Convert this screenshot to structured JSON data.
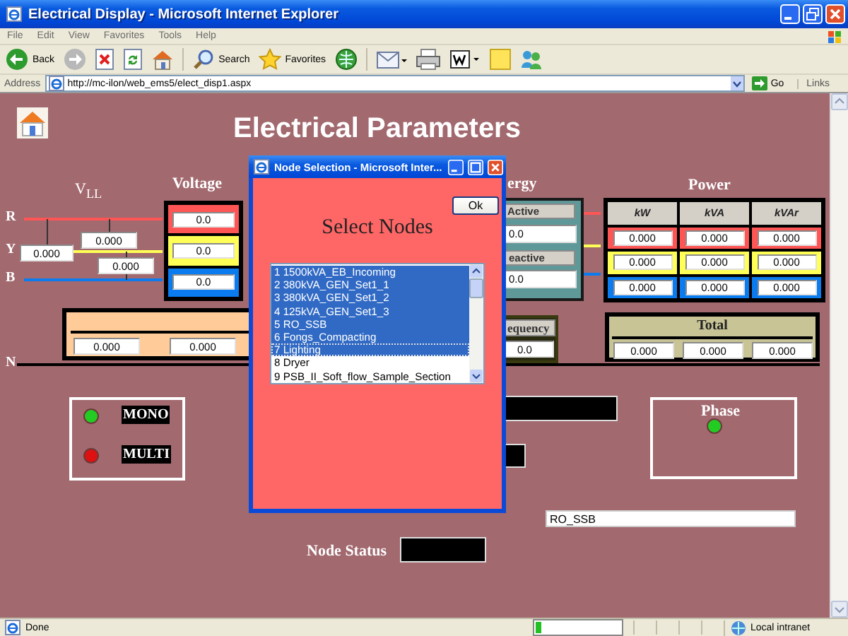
{
  "window": {
    "title": "Electrical Display - Microsoft Internet Explorer"
  },
  "menu": [
    "File",
    "Edit",
    "View",
    "Favorites",
    "Tools",
    "Help"
  ],
  "toolbar": [
    {
      "kind": "back",
      "label": "Back"
    },
    {
      "kind": "forward"
    },
    {
      "kind": "stop"
    },
    {
      "kind": "refresh"
    },
    {
      "kind": "home"
    },
    {
      "kind": "search",
      "label": "Search"
    },
    {
      "kind": "favorites",
      "label": "Favorites"
    },
    {
      "kind": "media"
    },
    {
      "kind": "mail"
    },
    {
      "kind": "print"
    },
    {
      "kind": "edit"
    },
    {
      "kind": "note"
    },
    {
      "kind": "messenger"
    }
  ],
  "address": {
    "label": "Address",
    "url": "http://mc-ilon/web_ems5/elect_disp1.aspx",
    "go": "Go",
    "links": "Links"
  },
  "page": {
    "title": "Electrical Parameters",
    "phases": [
      {
        "label": "R",
        "color": "#ff5555"
      },
      {
        "label": "Y",
        "color": "#ffff55"
      },
      {
        "label": "B",
        "color": "#0a7cf0"
      },
      {
        "label": "N",
        "color": "#000000"
      }
    ],
    "vll": {
      "label": "V$_{LL}$",
      "values": [
        "0.000",
        "0.000",
        "0.000"
      ]
    },
    "voltage": {
      "title": "Voltage",
      "values": [
        "0.0",
        "0.0",
        "0.0"
      ]
    },
    "neutral_values": [
      "0.000",
      "0.000"
    ],
    "energy": {
      "title": "ergy",
      "active_label": "Active",
      "active_value": "0.0",
      "reactive_label": "eactive",
      "reactive_value": "0.0"
    },
    "frequency": {
      "label": "equency",
      "value": "0.0"
    },
    "power": {
      "title": "Power",
      "columns": [
        "kW",
        "kVA",
        "kVAr"
      ],
      "rows": [
        [
          "0.000",
          "0.000",
          "0.000"
        ],
        [
          "0.000",
          "0.000",
          "0.000"
        ],
        [
          "0.000",
          "0.000",
          "0.000"
        ]
      ]
    },
    "total": {
      "title": "Total",
      "values": [
        "0.000",
        "0.000",
        "0.000"
      ]
    },
    "modes": [
      {
        "label": "MONO",
        "color": "#22cc22"
      },
      {
        "label": "MULTI",
        "color": "#dd1111"
      }
    ],
    "phase": {
      "title": "Phase",
      "color": "#22cc22"
    },
    "selected_node": "RO_SSB",
    "node_status": {
      "label": "Node Status"
    }
  },
  "popup": {
    "title": "Node Selection - Microsoft Inter...",
    "ok": "Ok",
    "heading": "Select Nodes",
    "nodes": [
      {
        "label": "1 1500kVA_EB_Incoming",
        "selected": true,
        "focused": false
      },
      {
        "label": "2 380kVA_GEN_Set1_1",
        "selected": true,
        "focused": false
      },
      {
        "label": "3 380kVA_GEN_Set1_2",
        "selected": true,
        "focused": false
      },
      {
        "label": "4 125kVA_GEN_Set1_3",
        "selected": true,
        "focused": false
      },
      {
        "label": "5 RO_SSB",
        "selected": true,
        "focused": false
      },
      {
        "label": "6 Fongs_Compacting",
        "selected": true,
        "focused": false
      },
      {
        "label": "7 Lighting",
        "selected": true,
        "focused": true
      },
      {
        "label": "8 Dryer",
        "selected": false,
        "focused": false
      },
      {
        "label": "9 PSB_II_Soft_flow_Sample_Section",
        "selected": false,
        "focused": false
      }
    ]
  },
  "status_bar": {
    "text": "Done",
    "progress": {
      "level": 0.06
    },
    "zone": "Local intranet"
  }
}
